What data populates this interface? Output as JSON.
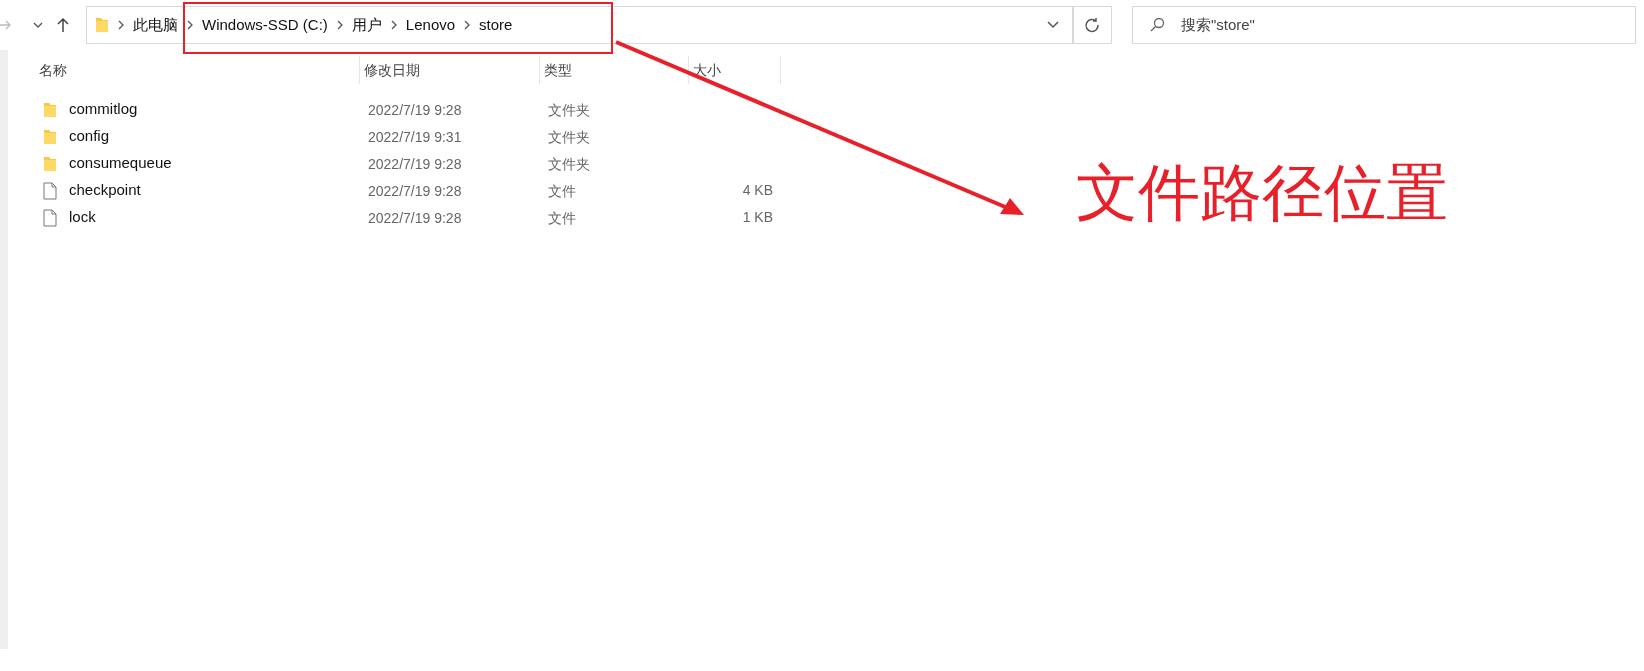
{
  "address_bar": {
    "segments": [
      "此电脑",
      "Windows-SSD (C:)",
      "用户",
      "Lenovo",
      "store"
    ]
  },
  "search": {
    "placeholder": "搜索\"store\""
  },
  "table": {
    "columns": [
      "名称",
      "修改日期",
      "类型",
      "大小"
    ],
    "rows": [
      {
        "kind": "folder",
        "name": "commitlog",
        "date": "2022/7/19 9:28",
        "type": "文件夹"
      },
      {
        "kind": "folder",
        "name": "config",
        "date": "2022/7/19 9:31",
        "type": "文件夹"
      },
      {
        "kind": "folder",
        "name": "consumequeue",
        "date": "2022/7/19 9:28",
        "type": "文件夹"
      },
      {
        "kind": "file",
        "name": "checkpoint",
        "date": "2022/7/19 9:28",
        "type": "文件",
        "size": "4 KB"
      },
      {
        "kind": "file",
        "name": "lock",
        "date": "2022/7/19 9:28",
        "type": "文件",
        "size": "1 KB"
      }
    ]
  },
  "annotation": {
    "label": "文件路径位置"
  }
}
